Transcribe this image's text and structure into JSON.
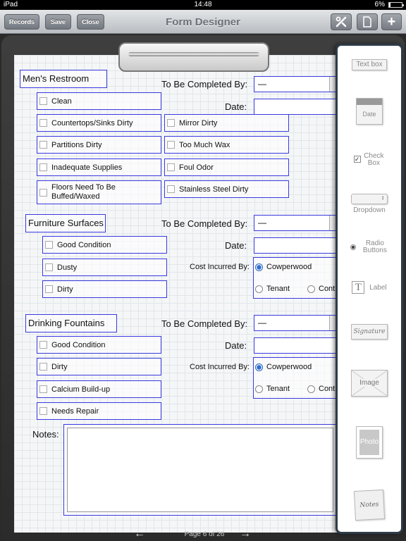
{
  "status_bar": {
    "device": "iPad",
    "time": "14:48",
    "battery": "6%"
  },
  "toolbar": {
    "records_label": "Records",
    "save_label": "Save",
    "close_label": "Close",
    "title": "Form Designer"
  },
  "form": {
    "sections": [
      {
        "title": "Men's Restroom",
        "to_be_completed_label": "To Be Completed By:",
        "to_be_completed_value": "—",
        "date_label": "Date:",
        "checkboxes_left": [
          "Clean",
          "Countertops/Sinks Dirty",
          "Partitions Dirty",
          "Inadequate Supplies",
          "Floors Need To Be Buffed/Waxed"
        ],
        "checkboxes_right": [
          "Mirror Dirty",
          "Too Much Wax",
          "Foul Odor",
          "Stainless Steel Dirty"
        ]
      },
      {
        "title": "Furniture Surfaces",
        "to_be_completed_label": "To Be Completed By:",
        "to_be_completed_value": "—",
        "date_label": "Date:",
        "checkboxes": [
          "Good Condition",
          "Dusty",
          "Dirty"
        ],
        "cost_label": "Cost Incurred By:",
        "radios": [
          "Cowperwood",
          "Tenant",
          "Cont"
        ]
      },
      {
        "title": "Drinking Fountains",
        "to_be_completed_label": "To Be Completed By:",
        "to_be_completed_value": "—",
        "date_label": "Date:",
        "checkboxes": [
          "Good Condition",
          "Dirty",
          "Calcium Build-up",
          "Needs Repair"
        ],
        "cost_label": "Cost Incurred By:",
        "radios": [
          "Cowperwood",
          "Tenant",
          "Cont"
        ]
      }
    ],
    "notes_label": "Notes:"
  },
  "page_nav": {
    "page_text": "Page 6 of 26"
  },
  "palette": {
    "items": [
      "Text box",
      "Date",
      "Check Box",
      "Dropdown",
      "Radio Buttons",
      "Label",
      "Signature",
      "Image",
      "Photo",
      "Notes"
    ]
  }
}
